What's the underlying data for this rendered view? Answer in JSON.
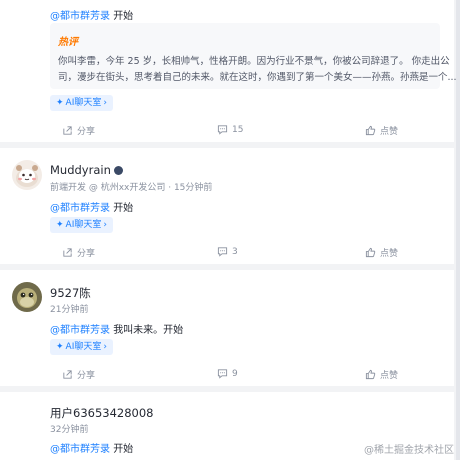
{
  "posts": [
    {
      "ref_link": "@都市群芳录",
      "ref_text": "开始",
      "hot_label": "热评",
      "hot_lines": [
        "你叫李雷，今年 25 岁，长相帅气，性格开朗。因为行业不景气，你被公司辞退了。 你走出公",
        "司，漫步在街头，思考着自己的未来。就在这时，你遇到了第一个美女——孙燕。孙燕是一个..."
      ],
      "ai_label": "AI聊天室",
      "share_label": "分享",
      "comment_count": "15",
      "like_label": "点赞"
    },
    {
      "username": "Muddyrain",
      "meta": "前端开发 @ 杭州xx开发公司 · 15分钟前",
      "ref_link": "@都市群芳录",
      "ref_text": "开始",
      "ai_label": "AI聊天室",
      "share_label": "分享",
      "comment_count": "3",
      "like_label": "点赞"
    },
    {
      "username": "9527陈",
      "meta": "21分钟前",
      "ref_link": "@都市群芳录",
      "ref_text": "我叫未来。开始",
      "ai_label": "AI聊天室",
      "share_label": "分享",
      "comment_count": "9",
      "like_label": "点赞"
    },
    {
      "username": "用户63653428008",
      "meta": "32分钟前",
      "ref_link": "@都市群芳录",
      "ref_text": "开始"
    }
  ],
  "watermark": "@稀土掘金技术社区",
  "colors": {
    "link": "#1e80ff",
    "hot": "#ff7a00",
    "muted": "#8a919f",
    "bg": "#f2f3f5"
  }
}
